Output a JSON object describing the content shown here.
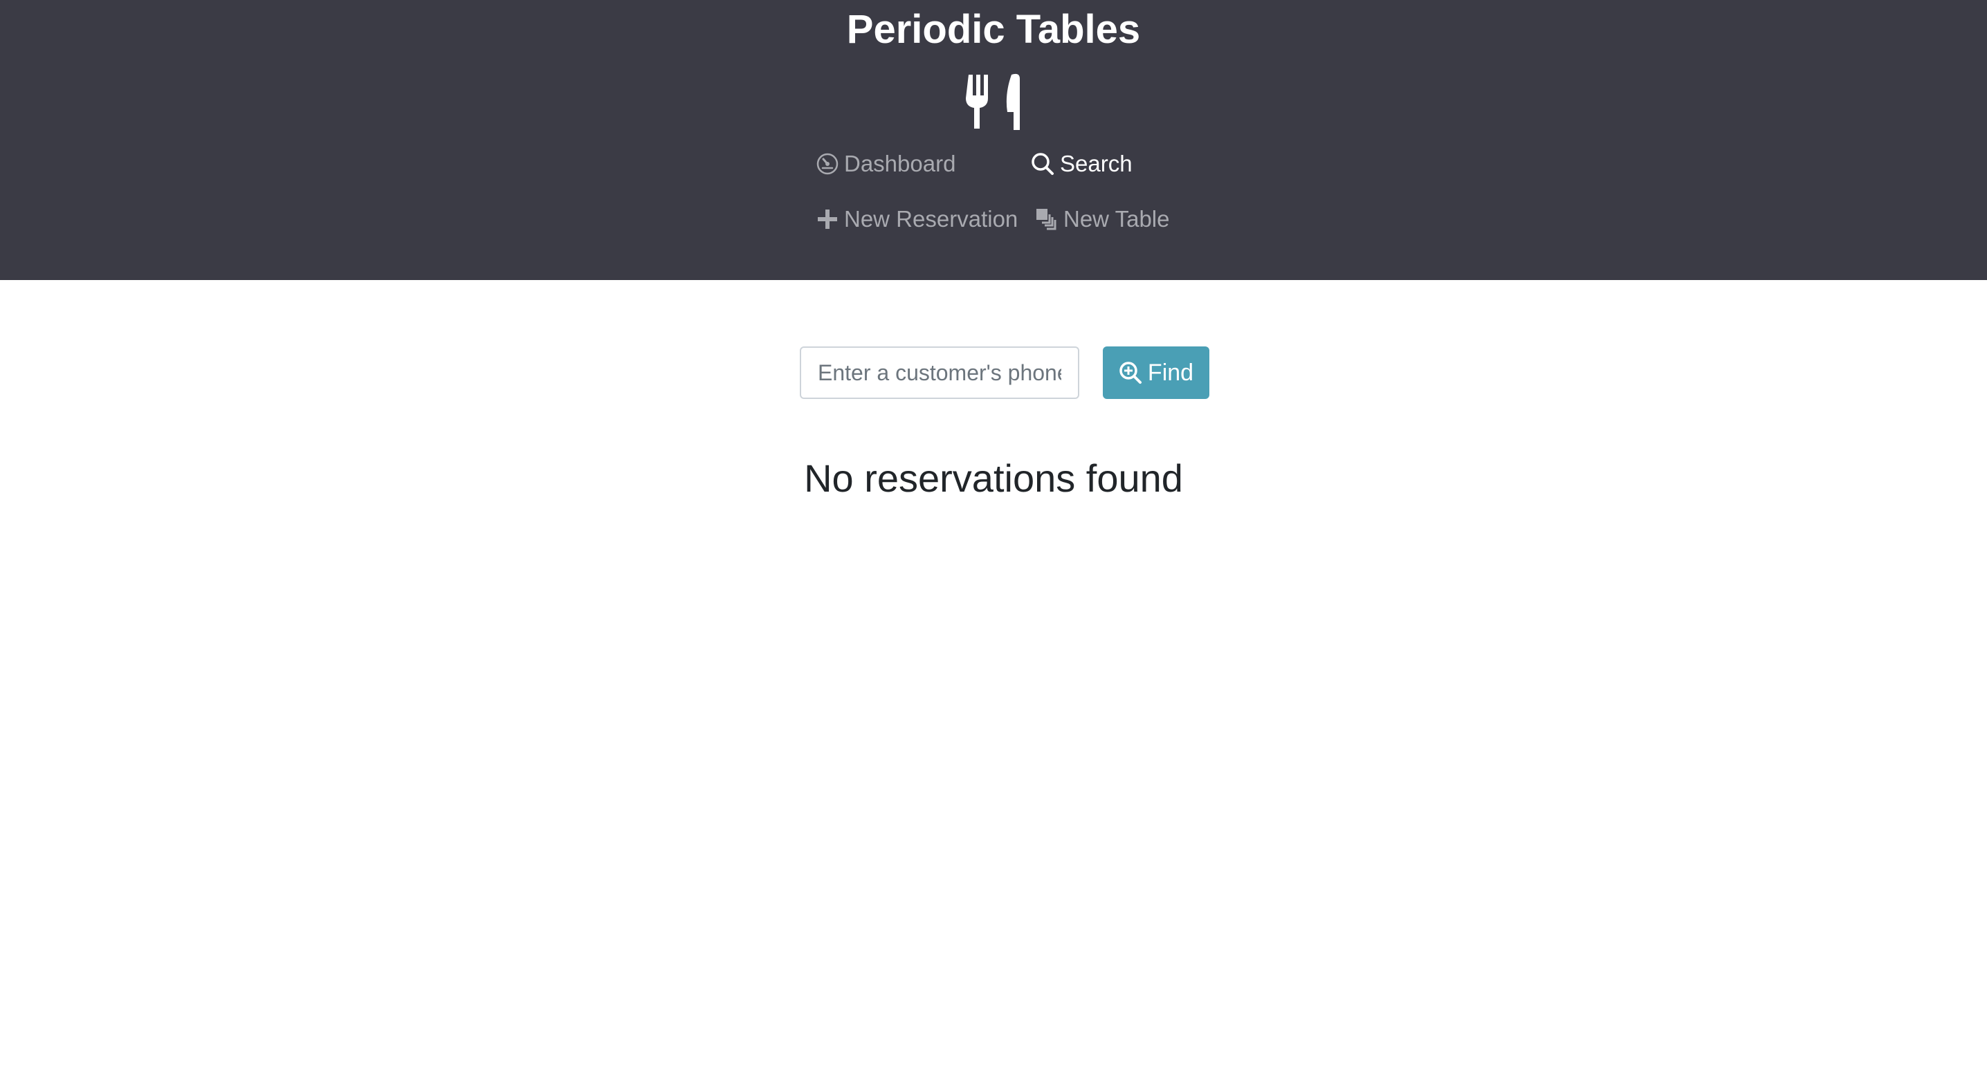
{
  "app": {
    "title": "Periodic Tables",
    "logo_icon": "utensils-icon"
  },
  "nav": {
    "items": [
      {
        "label": "Dashboard",
        "icon": "dashboard-icon",
        "active": false
      },
      {
        "label": "Search",
        "icon": "search-icon",
        "active": true
      },
      {
        "label": "New Reservation",
        "icon": "plus-icon",
        "active": false
      },
      {
        "label": "New Table",
        "icon": "layers-icon",
        "active": false
      }
    ]
  },
  "search": {
    "placeholder": "Enter a customer's phone number",
    "value": "",
    "button_label": "Find",
    "button_icon": "zoom-in-icon"
  },
  "results": {
    "empty_message": "No reservations found"
  },
  "colors": {
    "header_bg": "#3b3b45",
    "accent": "#4a9fb5",
    "nav_inactive": "#a9aab0",
    "nav_active": "#ffffff"
  }
}
